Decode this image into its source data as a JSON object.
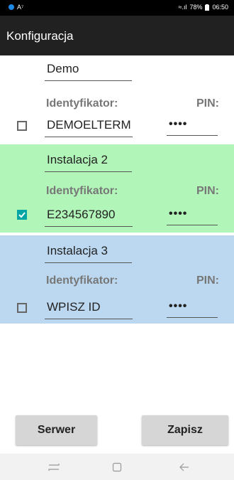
{
  "status_bar": {
    "left_icon": "notification-dot-icon",
    "left_text": "A⁷",
    "signal": "≈.ıl",
    "battery_text": "78%",
    "time": "06:50"
  },
  "app_bar": {
    "title": "Konfiguracja"
  },
  "installations": [
    {
      "name": "Demo",
      "id_label": "Identyfikator:",
      "pin_label": "PIN:",
      "checked": false,
      "identifier": "DEMOELTERM",
      "pin": "••••",
      "bg_color": "#ffffff"
    },
    {
      "name": "Instalacja 2",
      "id_label": "Identyfikator:",
      "pin_label": "PIN:",
      "checked": true,
      "identifier": "E234567890",
      "pin": "••••",
      "bg_color": "#b2f5b9"
    },
    {
      "name": "Instalacja 3",
      "id_label": "Identyfikator:",
      "pin_label": "PIN:",
      "checked": false,
      "identifier": "WPISZ ID",
      "pin": "••••",
      "bg_color": "#bcd8f0"
    }
  ],
  "buttons": {
    "server": "Serwer",
    "save": "Zapisz"
  },
  "nav": {
    "recent": "recent-apps-icon",
    "home": "home-icon",
    "back": "back-icon"
  },
  "colors": {
    "checkbox_checked": "#00a5a5",
    "app_bar": "#212121"
  }
}
